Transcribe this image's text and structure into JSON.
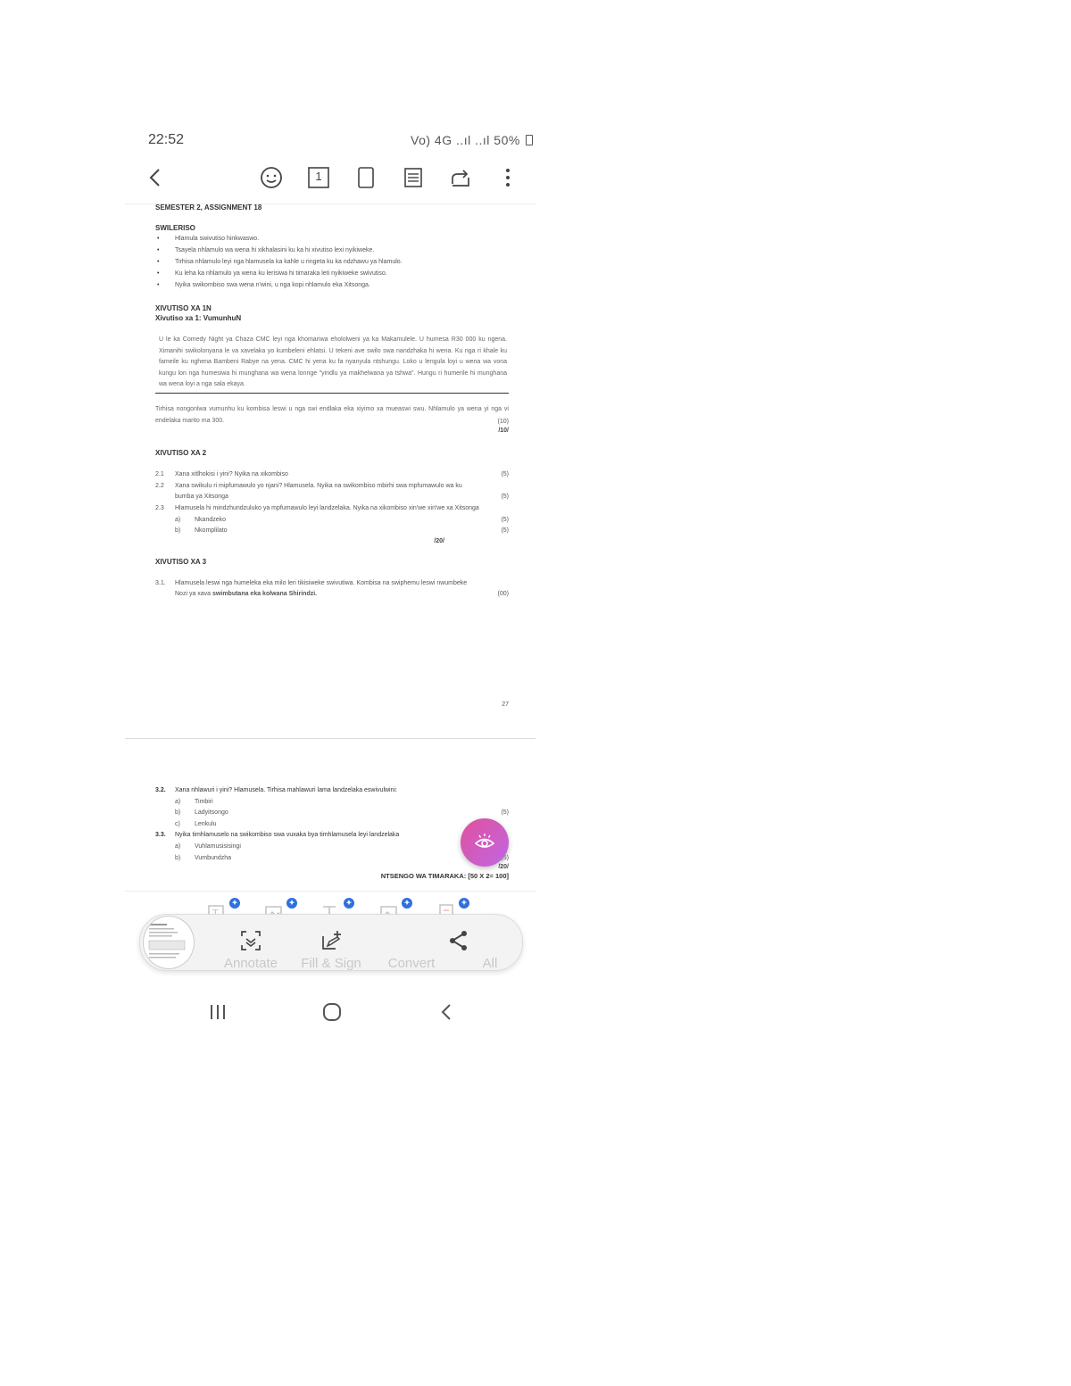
{
  "status_bar": {
    "time": "22:52",
    "indicators": "Vo) 4G ..ıl ..ıl 50%",
    "battery_icon": "battery-icon"
  },
  "toolbar": {
    "icons": [
      "back-arrow-icon",
      "smiley-icon",
      "page-number-icon",
      "page-view-icon",
      "reader-mode-icon",
      "rotate-icon",
      "more-options-icon"
    ],
    "page_number": "1"
  },
  "document": {
    "header": "SEMESTER 2, ASSIGNMENT 18",
    "section_swi_eriso": "SWILERISO",
    "bullets": [
      "Hlamula swivutiso hinkwaswo.",
      "Tsayela nhlamulo wa wena hi xikhalasini ku ka hi xivutiso lexi nyikiweke.",
      "Tirhisa nhlamulo leyi nga hlamusela ka kahle u ringeta ku ka ndzhawu ya hlamulo.",
      "Ku leha ka nhlamulo ya wena ku lerisiwa hi timaraka leti nyikiweke swivutiso.",
      "Nyika swikombiso swa wena n'wini, u nga kopi nhlamulo eka Xitsonga."
    ],
    "xivutiso_1_title": "XIVUTISO XA 1N",
    "xivutiso_1_subtitle": "Xivutiso xa 1: VumunhuN",
    "paragraph": "U le ka Comedy Night ya Chaza CMC leyi nga khomariwa ehololweni ya ka Makamulele. U humesa R30 000 ku ngena. Ximanihi swikolonyana le va xavelaka yo kumbeleni ehlatsi. U tekeni ave swilo swa nandzhaka hi wena. Ku nga ri khale ku fameile ku nghena Bambeni Rabye na yena. CMC hi yena ku fa nyanyula ntshungu. Loko u lengula loyi u wena wa vona kungu lon nga humesiwa hi munghana wa wena lonnge \"yindlu ya makhelwana ya tshwa\". Hungu ri humerile hi munghana wa wena loyi a nga sala ekaya.",
    "instruction_1": "Tirhisa nongonlwa vumunhu ku kombisa leswi u nga swi endlaka eka xiyimo xa mueaswi swu. Nhlamulo ya wena yi nga vi endelaka marito ma 300.",
    "mark_1": "(10)",
    "total_1": "/10/",
    "xivutiso_2_title": "XIVUTISO XA 2",
    "q2": [
      {
        "num": "2.1",
        "text": "Xana xitlhokisi i yini? Nyika na xikombiso",
        "mark": "(5)"
      },
      {
        "num": "2.2",
        "text": "Xana swikulu ri mipfumawulo yo njani? Hlamusela. Nyika na swikombiso mbirhi swa mpfumawulo wa ku bumba ya Xitsonga",
        "mark": "(5)"
      },
      {
        "num": "2.3",
        "text": "Hlamusela hi mindzhundzuluko ya mpfumawulo leyi landzelaka. Nyika na xikombiso xin'we xin'we xa Xitsonga",
        "mark": ""
      },
      {
        "num": "a)",
        "text": "Nkandzeko",
        "mark": "(5)"
      },
      {
        "num": "b)",
        "text": "Nkomplilato",
        "mark": "(5)"
      }
    ],
    "total_2": "/20/",
    "xivutiso_3_title": "XIVUTISO XA 3",
    "q3_1_num": "3.1.",
    "q3_1_text": "Hlamusela leswi nga humeleka eka milo leri tikisiweke swivutiwa. Kombisa na swiphemu leswi nwumbeke",
    "q3_1_line2_pre": "Nozi ya xava ",
    "q3_1_line2_bold": "swimbutana eka kolwana Shirindzi.",
    "q3_1_mark": "(00)",
    "page_number": "27",
    "q3_2_num": "3.2.",
    "q3_2_text": "Xana nhlawuri i yini? Hlamusela. Tirhisa mahlawuri lama landzelaka eswivulwini:",
    "q3_2_items": [
      {
        "num": "a)",
        "text": "Timbiri"
      },
      {
        "num": "b)",
        "text": "Ladyitsongo"
      },
      {
        "num": "c)",
        "text": "Lenkulu"
      }
    ],
    "q3_2_mark": "(5)",
    "q3_3_num": "3.3.",
    "q3_3_text": "Nyika timhlamuselo na swikombiso swa vuxaka bya timhlamusela leyi landzelaka",
    "q3_3_items": [
      {
        "num": "a)",
        "text": "Vuhlamusisisingi"
      },
      {
        "num": "b)",
        "text": "Vumbundzha"
      }
    ],
    "q3_3_mark": "(5)",
    "total_3": "/20/",
    "grand_total": "NTSENGO WA TIMARAKA: [50 X 2= 100]"
  },
  "fab": {
    "icon": "eye-icon"
  },
  "edit_tools": {
    "icons": [
      "edit-text-icon",
      "edit-image-icon",
      "add-text-icon",
      "add-image-icon",
      "add-page-icon"
    ],
    "badge_icon": "ai-badge-icon"
  },
  "bottom_bar": {
    "annotate": "Annotate",
    "fill_sign": "Fill & Sign",
    "convert": "Convert",
    "all": "All"
  },
  "nav_bar": {
    "icons": [
      "recent-apps-icon",
      "home-icon",
      "nav-back-icon"
    ]
  },
  "colors": {
    "fab_gradient_start": "#e0509c",
    "fab_gradient_end": "#c066e4",
    "badge_blue": "#2f6fe0"
  }
}
